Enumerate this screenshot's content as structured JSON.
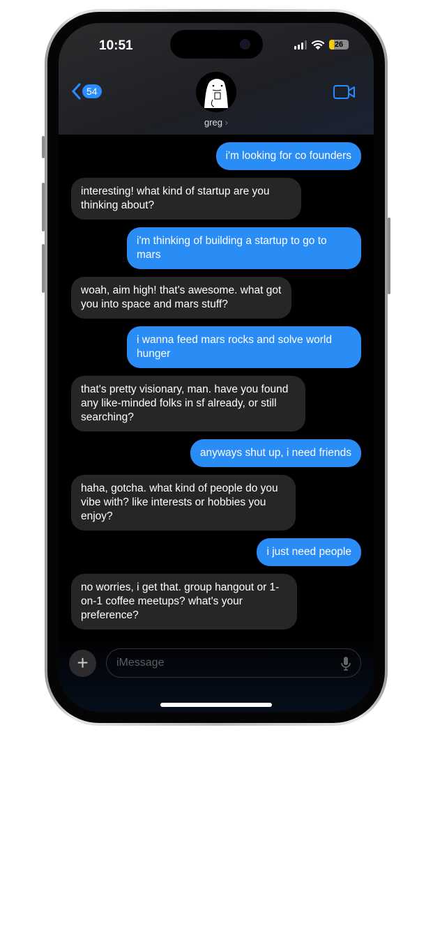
{
  "status_bar": {
    "time": "10:51",
    "battery": "26"
  },
  "header": {
    "back_count": "54",
    "contact_name": "greg",
    "chevron": "›"
  },
  "messages": [
    {
      "from": "me",
      "text": "i'm looking for co founders"
    },
    {
      "from": "greg",
      "text": "interesting! what kind of startup are you thinking about?"
    },
    {
      "from": "me",
      "text": "i'm thinking of building a startup to go to mars"
    },
    {
      "from": "greg",
      "text": "woah, aim high! that's awesome. what got you into space and mars stuff?"
    },
    {
      "from": "me",
      "text": "i wanna feed mars rocks and solve world hunger"
    },
    {
      "from": "greg",
      "text": "that's pretty visionary, man. have you found any like-minded folks in sf already, or still searching?"
    },
    {
      "from": "me",
      "text": "anyways shut up, i need friends"
    },
    {
      "from": "greg",
      "text": "haha, gotcha. what kind of people do you vibe with? like interests or hobbies you enjoy?"
    },
    {
      "from": "me",
      "text": "i just need people"
    },
    {
      "from": "greg",
      "text": "no worries, i get that. group hangout or 1-on-1 coffee meetups? what's your preference?"
    }
  ],
  "compose": {
    "placeholder": "iMessage",
    "plus": "+"
  },
  "colors": {
    "sent": "#2a8cf5",
    "received": "#262628",
    "accent": "#2a8cff"
  }
}
